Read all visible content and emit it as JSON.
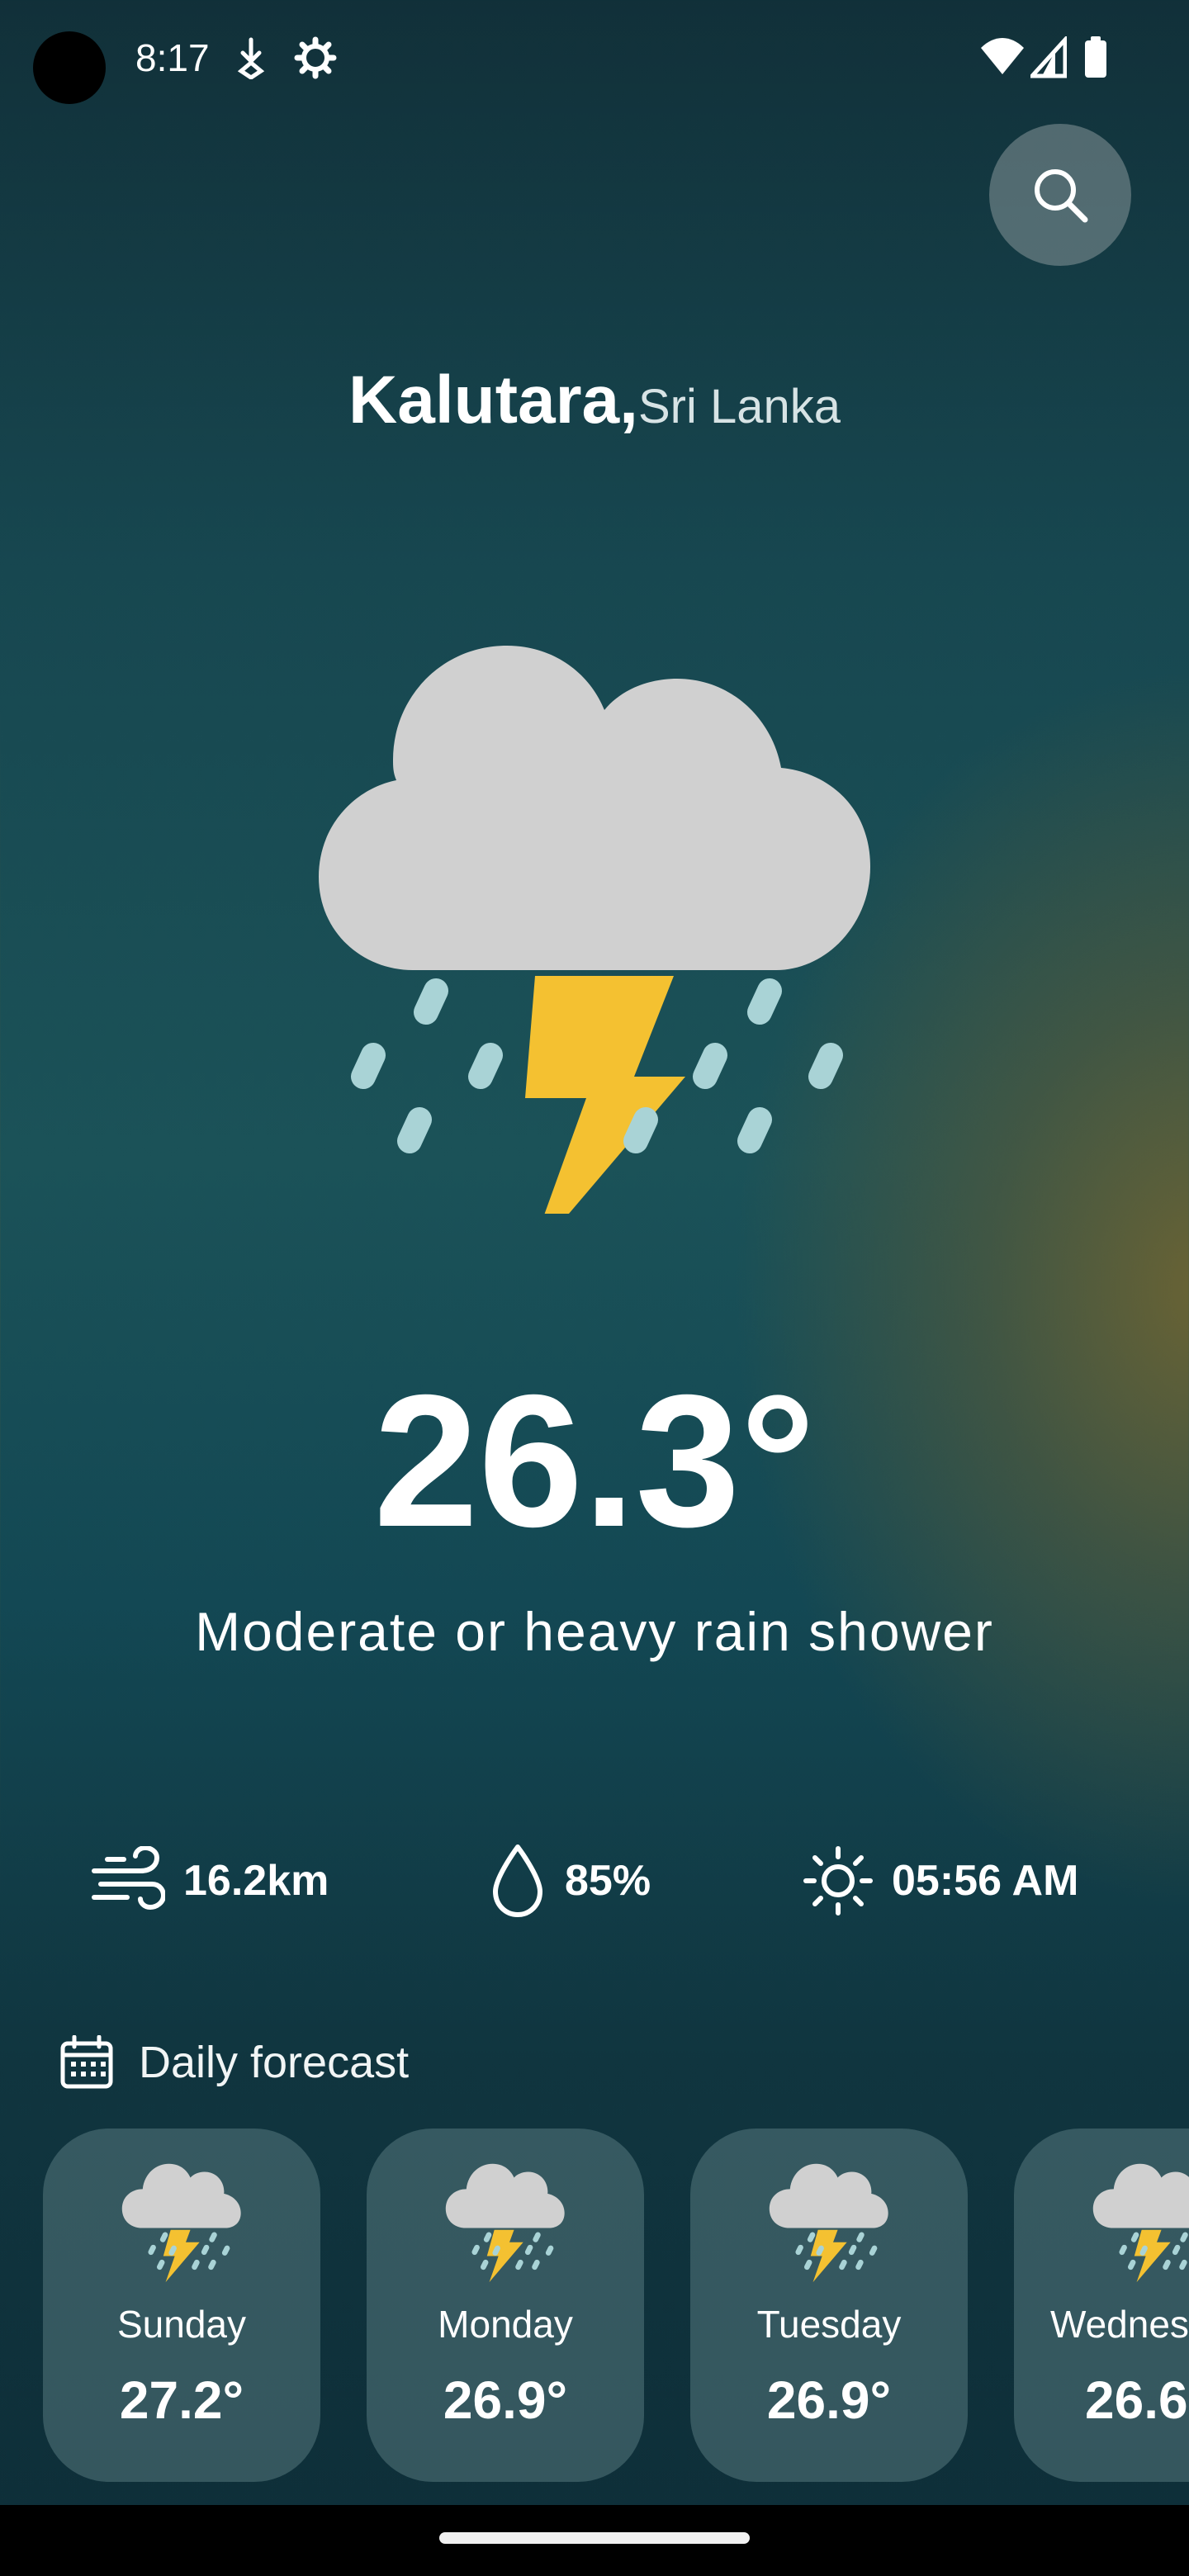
{
  "status_bar": {
    "time": "8:17"
  },
  "location": {
    "city": "Kalutara,",
    "country": "Sri Lanka"
  },
  "current": {
    "temperature": "26.3°",
    "condition": "Moderate or heavy rain shower",
    "icon": "thunderstorm-rain-icon"
  },
  "stats": {
    "wind": "16.2km",
    "humidity": "85%",
    "sunrise": "05:56 AM"
  },
  "daily": {
    "label": "Daily forecast",
    "days": [
      {
        "day": "Sunday",
        "temp": "27.2°",
        "icon": "thunderstorm-rain-icon"
      },
      {
        "day": "Monday",
        "temp": "26.9°",
        "icon": "thunderstorm-rain-icon"
      },
      {
        "day": "Tuesday",
        "temp": "26.9°",
        "icon": "thunderstorm-rain-icon"
      },
      {
        "day": "Wednes",
        "temp": "26.6",
        "icon": "thunderstorm-rain-icon"
      }
    ]
  },
  "colors": {
    "cloud": "#d0d0d0",
    "bolt": "#f4c131",
    "rain": "#a9d3d6"
  }
}
